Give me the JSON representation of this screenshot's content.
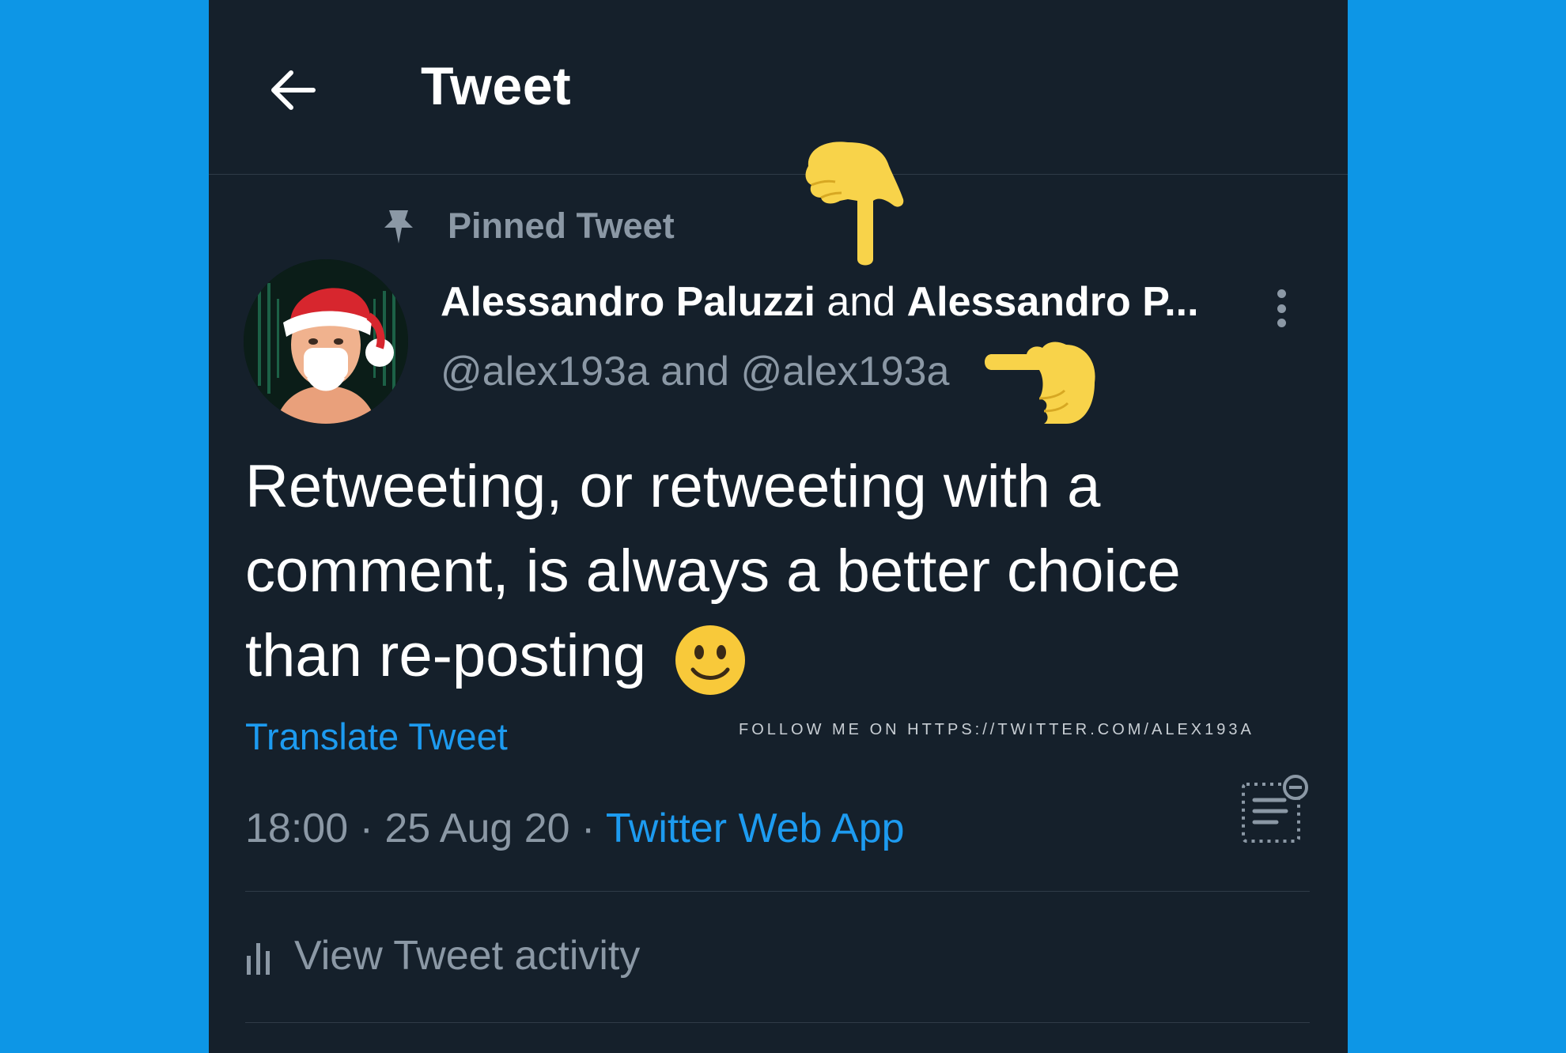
{
  "header": {
    "title": "Tweet",
    "back_icon": "arrow-left-icon"
  },
  "pinned": {
    "label": "Pinned Tweet",
    "icon": "pin-icon"
  },
  "author": {
    "name1": "Alessandro Paluzzi",
    "conjunction": "and",
    "name2": "Alessandro P...",
    "handles": "@alex193a and @alex193a"
  },
  "tweet": {
    "text": "Retweeting, or retweeting with a comment, is always a better choice than re-posting",
    "emoji": "slightly-smiling-face"
  },
  "translate_label": "Translate Tweet",
  "watermark": "FOLLOW ME ON HTTPS://TWITTER.COM/ALEX193A",
  "meta": {
    "time": "18:00",
    "separator": " · ",
    "date": "25 Aug 20",
    "source": "Twitter Web App"
  },
  "activity": {
    "label": "View Tweet activity",
    "icon": "bar-chart-icon"
  },
  "colors": {
    "background": "#15202b",
    "outer": "#0d96e6",
    "accent": "#1d9bf0",
    "muted": "#8b98a5",
    "pointer_emoji": "#f8d34a"
  }
}
